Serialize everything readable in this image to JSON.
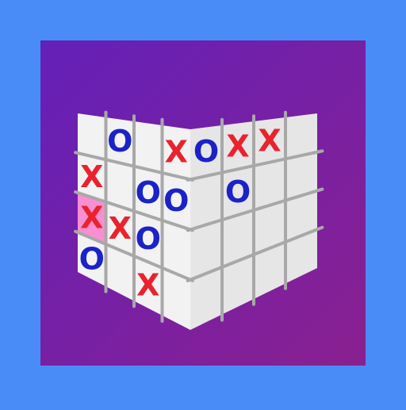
{
  "colors": {
    "outer_background": "#4a8cf7",
    "panel_gradient_start": "#6420b8",
    "panel_gradient_end": "#8a2090",
    "cube_face_left": "#f2f2f2",
    "cube_face_right": "#e6e6e6",
    "grid_line": "#a8a8a8",
    "mark_x": "#e8232e",
    "mark_o": "#1a22c8",
    "highlight_cell": "#f98fd2"
  },
  "game": {
    "board_size": 4,
    "left_face": {
      "cells": [
        [
          "",
          "O",
          "",
          "X"
        ],
        [
          "X",
          "",
          "O",
          "O"
        ],
        [
          "X",
          "X",
          "O",
          ""
        ],
        [
          "O",
          "",
          "X",
          ""
        ]
      ],
      "highlighted": [
        [
          2,
          0
        ]
      ]
    },
    "right_face": {
      "cells": [
        [
          "O",
          "X",
          "X",
          ""
        ],
        [
          "",
          "O",
          "",
          ""
        ],
        [
          "",
          "",
          "",
          ""
        ],
        [
          "",
          "",
          "",
          ""
        ]
      ]
    }
  }
}
